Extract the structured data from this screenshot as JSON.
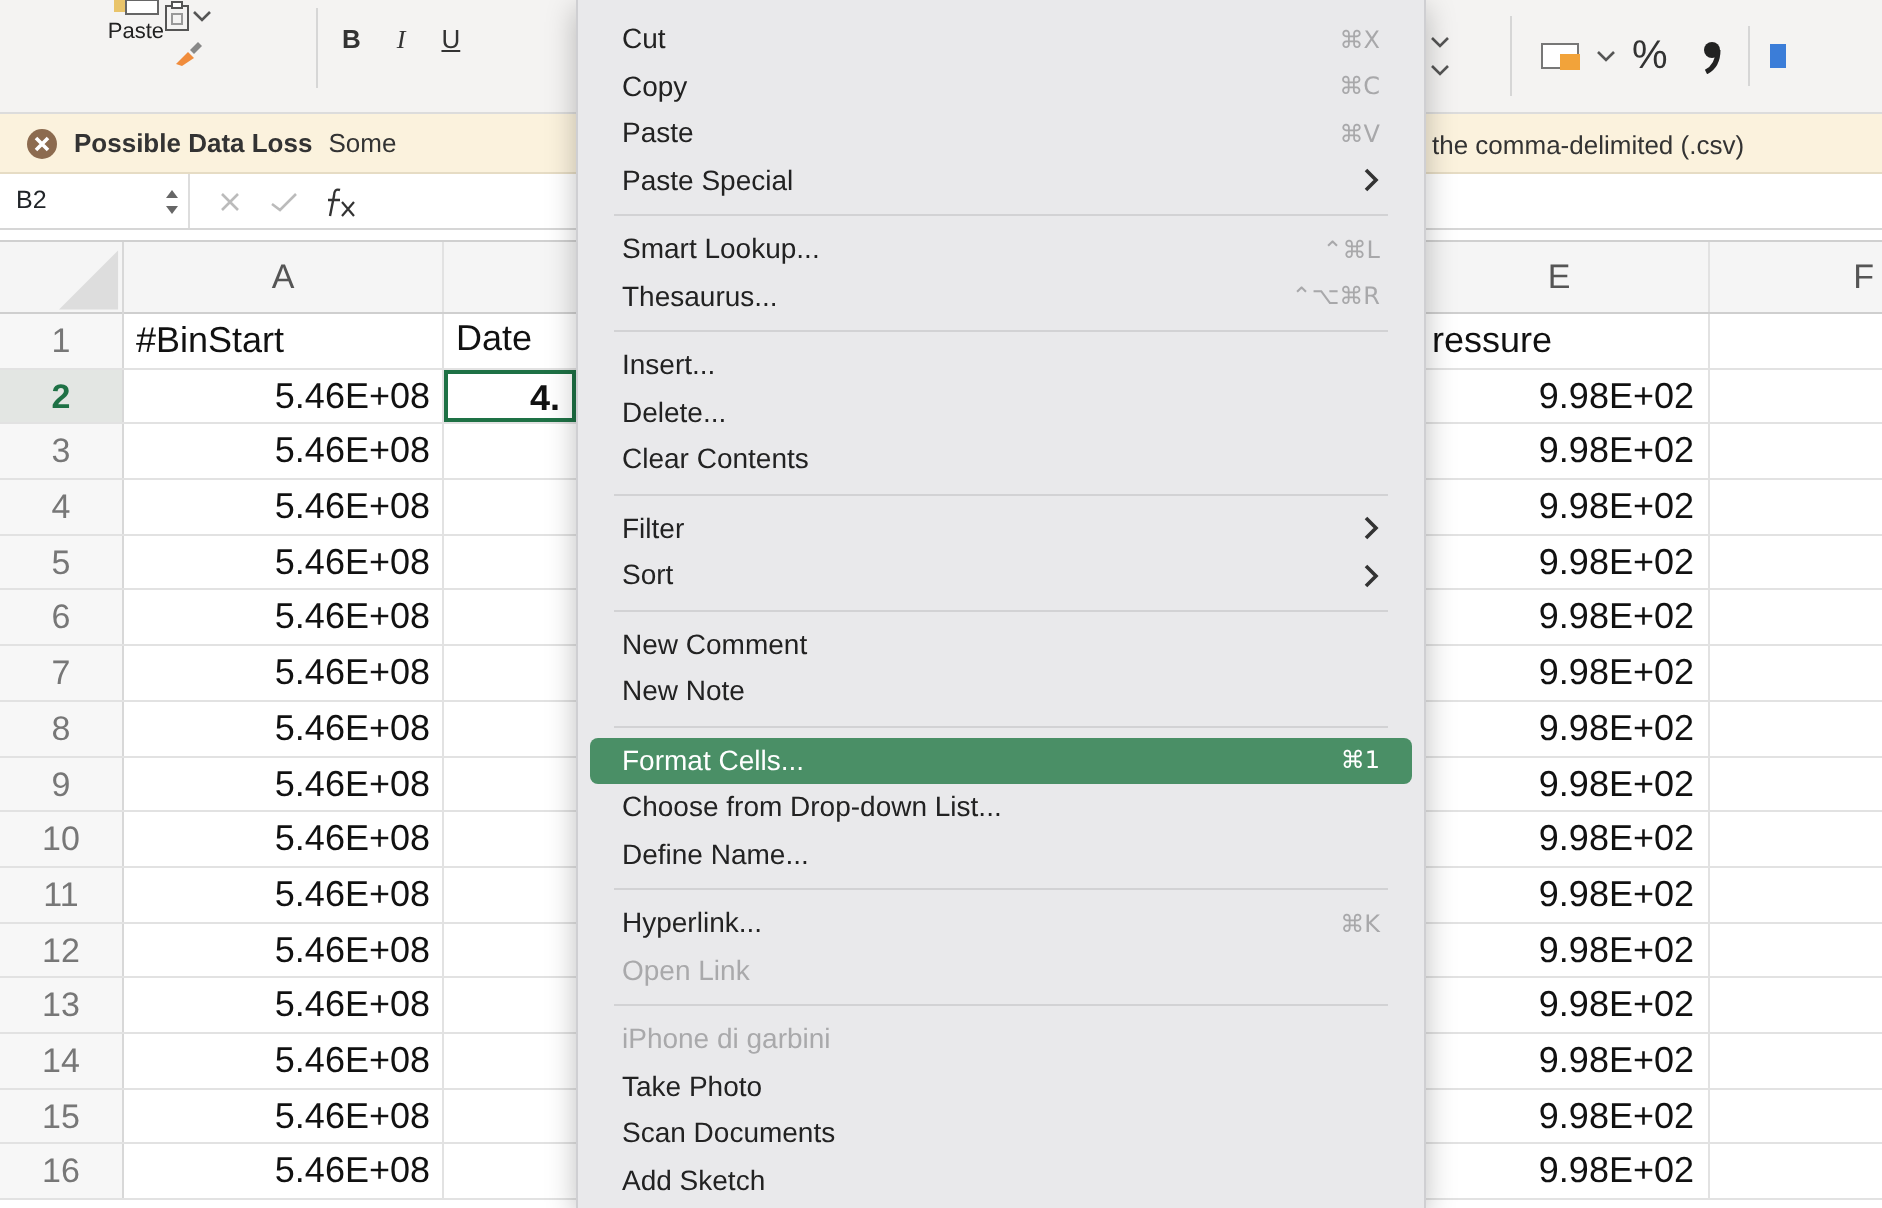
{
  "toolbar": {
    "paste_label": "Paste",
    "format_buttons": [
      "B",
      "I",
      "U"
    ],
    "percent": "%"
  },
  "warning": {
    "title": "Possible Data Loss",
    "text_left": "Some",
    "text_right": "the comma-delimited (.csv)"
  },
  "formula_bar": {
    "name_box": "B2"
  },
  "sheet": {
    "columns": [
      {
        "label": "A"
      },
      {
        "label": "E"
      },
      {
        "label": "F"
      }
    ],
    "rows": [
      {
        "number": "1",
        "selected": false,
        "a": "#BinStart",
        "b": "Date",
        "e": "ressure"
      },
      {
        "number": "2",
        "selected": true,
        "a": "5.46E+08",
        "b": "4.",
        "e": "9.98E+02"
      },
      {
        "number": "3",
        "selected": false,
        "a": "5.46E+08",
        "e": "9.98E+02"
      },
      {
        "number": "4",
        "selected": false,
        "a": "5.46E+08",
        "e": "9.98E+02"
      },
      {
        "number": "5",
        "selected": false,
        "a": "5.46E+08",
        "e": "9.98E+02"
      },
      {
        "number": "6",
        "selected": false,
        "a": "5.46E+08",
        "e": "9.98E+02"
      },
      {
        "number": "7",
        "selected": false,
        "a": "5.46E+08",
        "e": "9.98E+02"
      },
      {
        "number": "8",
        "selected": false,
        "a": "5.46E+08",
        "e": "9.98E+02"
      },
      {
        "number": "9",
        "selected": false,
        "a": "5.46E+08",
        "e": "9.98E+02"
      },
      {
        "number": "10",
        "selected": false,
        "a": "5.46E+08",
        "e": "9.98E+02"
      },
      {
        "number": "11",
        "selected": false,
        "a": "5.46E+08",
        "e": "9.98E+02"
      },
      {
        "number": "12",
        "selected": false,
        "a": "5.46E+08",
        "e": "9.98E+02"
      },
      {
        "number": "13",
        "selected": false,
        "a": "5.46E+08",
        "e": "9.98E+02"
      },
      {
        "number": "14",
        "selected": false,
        "a": "5.46E+08",
        "e": "9.98E+02"
      },
      {
        "number": "15",
        "selected": false,
        "a": "5.46E+08",
        "e": "9.98E+02"
      },
      {
        "number": "16",
        "selected": false,
        "a": "5.46E+08",
        "e": "9.98E+02"
      }
    ]
  },
  "context_menu": {
    "groups": [
      [
        {
          "label": "Cut",
          "shortcut": "⌘X",
          "disabled": false,
          "selected": false,
          "submenu": false
        },
        {
          "label": "Copy",
          "shortcut": "⌘C",
          "disabled": false,
          "selected": false,
          "submenu": false
        },
        {
          "label": "Paste",
          "shortcut": "⌘V",
          "disabled": false,
          "selected": false,
          "submenu": false
        },
        {
          "label": "Paste Special",
          "disabled": false,
          "selected": false,
          "submenu": true
        }
      ],
      [
        {
          "label": "Smart Lookup...",
          "shortcut": "⌃⌘L",
          "disabled": false,
          "selected": false,
          "submenu": false
        },
        {
          "label": "Thesaurus...",
          "shortcut": "⌃⌥⌘R",
          "disabled": false,
          "selected": false,
          "submenu": false
        }
      ],
      [
        {
          "label": "Insert...",
          "disabled": false,
          "selected": false,
          "submenu": false
        },
        {
          "label": "Delete...",
          "disabled": false,
          "selected": false,
          "submenu": false
        },
        {
          "label": "Clear Contents",
          "disabled": false,
          "selected": false,
          "submenu": false
        }
      ],
      [
        {
          "label": "Filter",
          "disabled": false,
          "selected": false,
          "submenu": true
        },
        {
          "label": "Sort",
          "disabled": false,
          "selected": false,
          "submenu": true
        }
      ],
      [
        {
          "label": "New Comment",
          "disabled": false,
          "selected": false,
          "submenu": false
        },
        {
          "label": "New Note",
          "disabled": false,
          "selected": false,
          "submenu": false
        }
      ],
      [
        {
          "label": "Format Cells...",
          "shortcut": "⌘1",
          "disabled": false,
          "selected": true,
          "submenu": false
        },
        {
          "label": "Choose from Drop-down List...",
          "disabled": false,
          "selected": false,
          "submenu": false
        },
        {
          "label": "Define Name...",
          "disabled": false,
          "selected": false,
          "submenu": false
        }
      ],
      [
        {
          "label": "Hyperlink...",
          "shortcut": "⌘K",
          "disabled": false,
          "selected": false,
          "submenu": false
        },
        {
          "label": "Open Link",
          "disabled": true,
          "selected": false,
          "submenu": false
        }
      ],
      [
        {
          "label": "iPhone di garbini",
          "disabled": true,
          "selected": false,
          "submenu": false
        },
        {
          "label": "Take Photo",
          "disabled": false,
          "selected": false,
          "submenu": false
        },
        {
          "label": "Scan Documents",
          "disabled": false,
          "selected": false,
          "submenu": false
        },
        {
          "label": "Add Sketch",
          "disabled": false,
          "selected": false,
          "submenu": false
        }
      ]
    ]
  }
}
